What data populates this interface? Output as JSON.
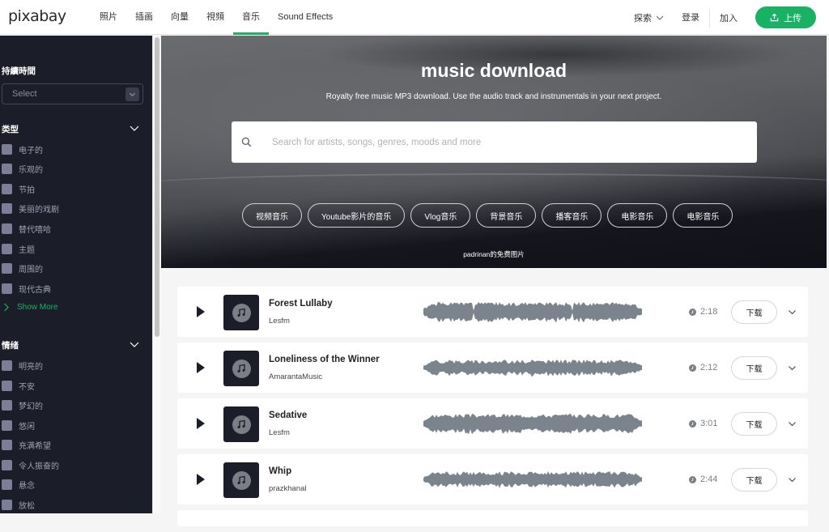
{
  "nav": {
    "logo": "pixabay",
    "links": [
      {
        "label": "照片",
        "active": false
      },
      {
        "label": "插画",
        "active": false
      },
      {
        "label": "向量",
        "active": false
      },
      {
        "label": "視頻",
        "active": false
      },
      {
        "label": "音乐",
        "active": true
      },
      {
        "label": "Sound Effects",
        "active": false
      }
    ],
    "explore_label": "探索",
    "login_label": "登录",
    "join_label": "加入",
    "upload_label": "上传",
    "accent_color": "#19b265"
  },
  "sidebar": {
    "duration": {
      "title": "持續時間",
      "select_placeholder": "Select"
    },
    "genre": {
      "title": "类型",
      "items": [
        "电子的",
        "乐观的",
        "节拍",
        "美丽的戏剧",
        "替代嘻哈",
        "主题",
        "周围的",
        "现代古典"
      ],
      "show_more_label": "Show More"
    },
    "mood": {
      "title": "情绪",
      "items": [
        "明亮的",
        "不安",
        "梦幻的",
        "悠闲",
        "充满希望",
        "令人振奋的",
        "悬念",
        "放松"
      ]
    }
  },
  "hero": {
    "title": "music download",
    "subtitle": "Royalty free music MP3 download. Use the audio track and instrumentals in your next project.",
    "search_placeholder": "Search for artists, songs, genres, moods and more",
    "search_value": "",
    "chips": [
      "视频音乐",
      "Youtube影片的音乐",
      "Vlog音乐",
      "背景音乐",
      "播客音乐",
      "电影音乐",
      "电影音乐"
    ],
    "credit": "padrinan的免费图片"
  },
  "tracks": [
    {
      "title": "Forest Lullaby",
      "artist": "Lesfm",
      "duration": "2:18",
      "download_label": "下载"
    },
    {
      "title": "Loneliness of the Winner",
      "artist": "AmarantaMusic",
      "duration": "2:12",
      "download_label": "下载"
    },
    {
      "title": "Sedative",
      "artist": "Lesfm",
      "duration": "3:01",
      "download_label": "下载"
    },
    {
      "title": "Whip",
      "artist": "prazkhanal",
      "duration": "2:44",
      "download_label": "下载"
    }
  ]
}
